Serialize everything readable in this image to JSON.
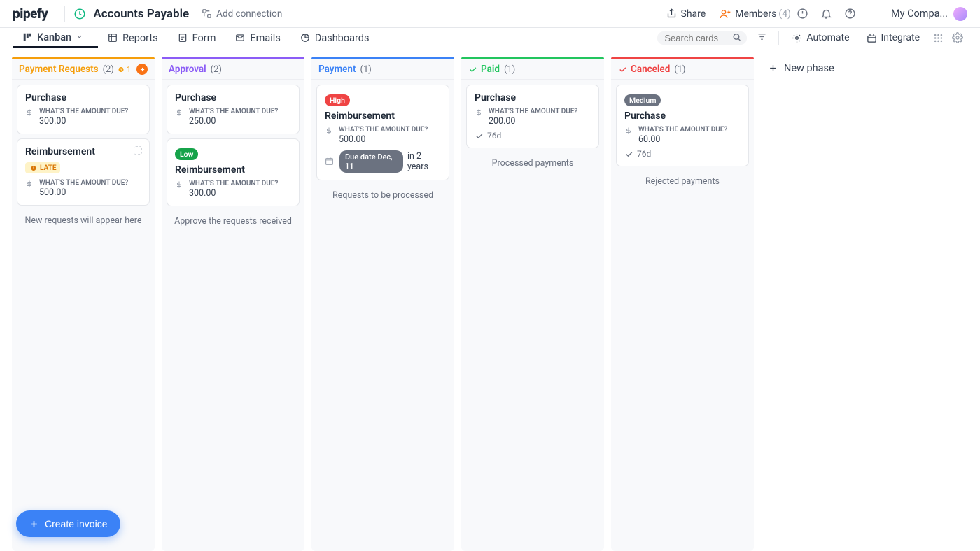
{
  "header": {
    "brand": "pipefy",
    "pipe_name": "Accounts Payable",
    "add_connection": "Add connection",
    "share": "Share",
    "members": "Members",
    "members_count": "(4)",
    "company": "My Compa..."
  },
  "tabs": {
    "kanban": "Kanban",
    "reports": "Reports",
    "form": "Form",
    "emails": "Emails",
    "dashboards": "Dashboards",
    "search_placeholder": "Search cards",
    "automate": "Automate",
    "integrate": "Integrate"
  },
  "board": {
    "amount_label": "WHAT'S THE AMOUNT DUE?",
    "new_phase": "New phase",
    "fab": "Create invoice",
    "phases": [
      {
        "title": "Payment Requests",
        "count": "(2)",
        "late_count": "1",
        "footer": "New requests will appear here",
        "cards": [
          {
            "title": "Purchase",
            "amount": "300.00"
          },
          {
            "title": "Reimbursement",
            "amount": "500.00",
            "late": "LATE",
            "assignee_slot": true
          }
        ]
      },
      {
        "title": "Approval",
        "count": "(2)",
        "footer": "Approve the requests received",
        "cards": [
          {
            "title": "Purchase",
            "amount": "250.00"
          },
          {
            "title": "Reimbursement",
            "amount": "300.00",
            "priority": "Low"
          }
        ]
      },
      {
        "title": "Payment",
        "count": "(1)",
        "footer": "Requests to be processed",
        "cards": [
          {
            "title": "Reimbursement",
            "amount": "500.00",
            "priority": "High",
            "due_pill": "Due date Dec, 11",
            "due_extra": "in 2 years"
          }
        ]
      },
      {
        "title": "Paid",
        "count": "(1)",
        "done": true,
        "footer": "Processed payments",
        "cards": [
          {
            "title": "Purchase",
            "amount": "200.00",
            "done": "76d"
          }
        ]
      },
      {
        "title": "Canceled",
        "count": "(1)",
        "done": true,
        "footer": "Rejected payments",
        "cards": [
          {
            "title": "Purchase",
            "amount": "60.00",
            "priority": "Medium",
            "done": "76d"
          }
        ]
      }
    ]
  }
}
